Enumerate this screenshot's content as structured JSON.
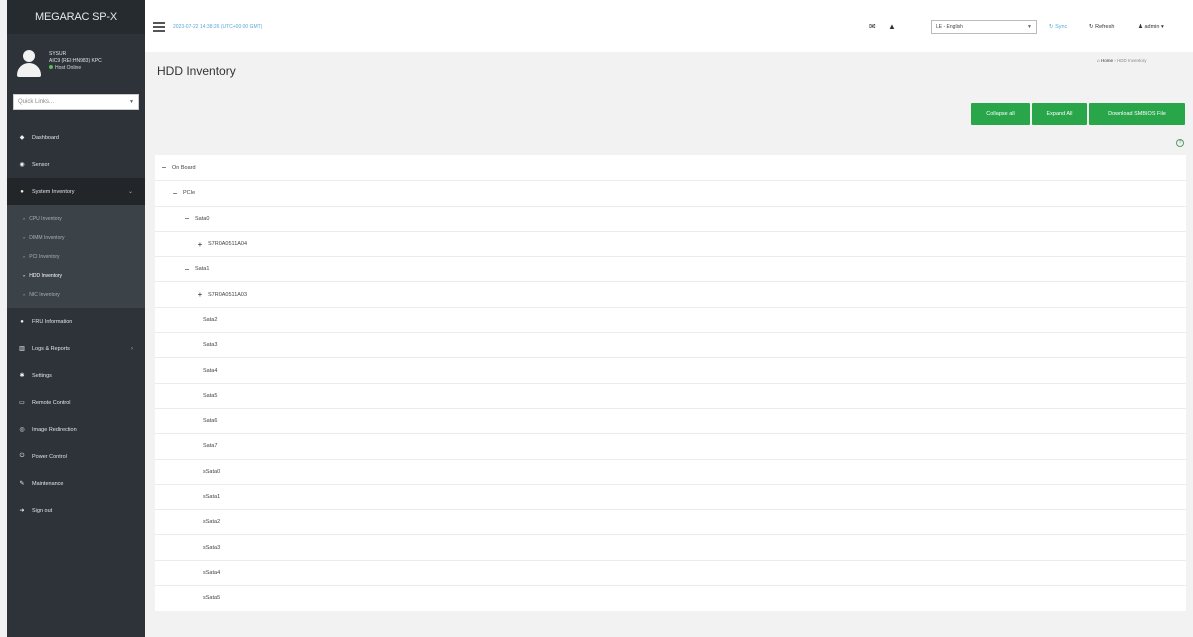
{
  "sidebar": {
    "brand": "MEGARAC SP-X",
    "user": {
      "name": "SYSUR",
      "line2": "AIC9 (REI:HN983) KPC",
      "status": "Host Online"
    },
    "quick_links_placeholder": "Quick Links...",
    "nav": [
      {
        "label": "Dashboard",
        "icon": "dashboard-icon"
      },
      {
        "label": "Sensor",
        "icon": "sensor-icon"
      },
      {
        "label": "System Inventory",
        "icon": "inventory-icon"
      },
      {
        "label": "FRU Information",
        "icon": "info-icon"
      },
      {
        "label": "Logs & Reports",
        "icon": "chart-icon"
      },
      {
        "label": "Settings",
        "icon": "gear-icon"
      },
      {
        "label": "Remote Control",
        "icon": "monitor-icon"
      },
      {
        "label": "Image Redirection",
        "icon": "image-icon"
      },
      {
        "label": "Power Control",
        "icon": "power-icon"
      },
      {
        "label": "Maintenance",
        "icon": "wrench-icon"
      },
      {
        "label": "Sign out",
        "icon": "signout-icon"
      }
    ],
    "sub_items": [
      {
        "label": "CPU Inventory"
      },
      {
        "label": "DIMM Inventory"
      },
      {
        "label": "PCI Inventory"
      },
      {
        "label": "HDD Inventory"
      },
      {
        "label": "NIC Inventory"
      }
    ]
  },
  "topbar": {
    "datetime": "2023-07-22 14:38:26 (UTC+00:00 GMT)",
    "language": "LE - English",
    "sync": "Sync",
    "refresh": "Refresh",
    "user": "admin"
  },
  "main": {
    "title": "HDD Inventory",
    "breadcrumb": {
      "home": "Home",
      "current": "HDD Inventory"
    },
    "buttons": {
      "collapse": "Collapse all",
      "expand": "Expand All",
      "download": "Download SMBIOS File"
    },
    "tree": {
      "root": "On Board",
      "pcie": "PCIe",
      "sata0": "Sata0",
      "sata0_child": "S7R0A0511A04",
      "sata1": "Sata1",
      "sata1_child": "S7R0A0511A03",
      "sata2": "Sata2",
      "sata3": "Sata3",
      "sata4": "Sata4",
      "sata5": "Sata5",
      "sata6": "Sata6",
      "sata7": "Sata7",
      "ssata0": "sSata0",
      "ssata1": "sSata1",
      "ssata2": "sSata2",
      "ssata3": "sSata3",
      "ssata4": "sSata4",
      "ssata5": "sSata5"
    }
  }
}
